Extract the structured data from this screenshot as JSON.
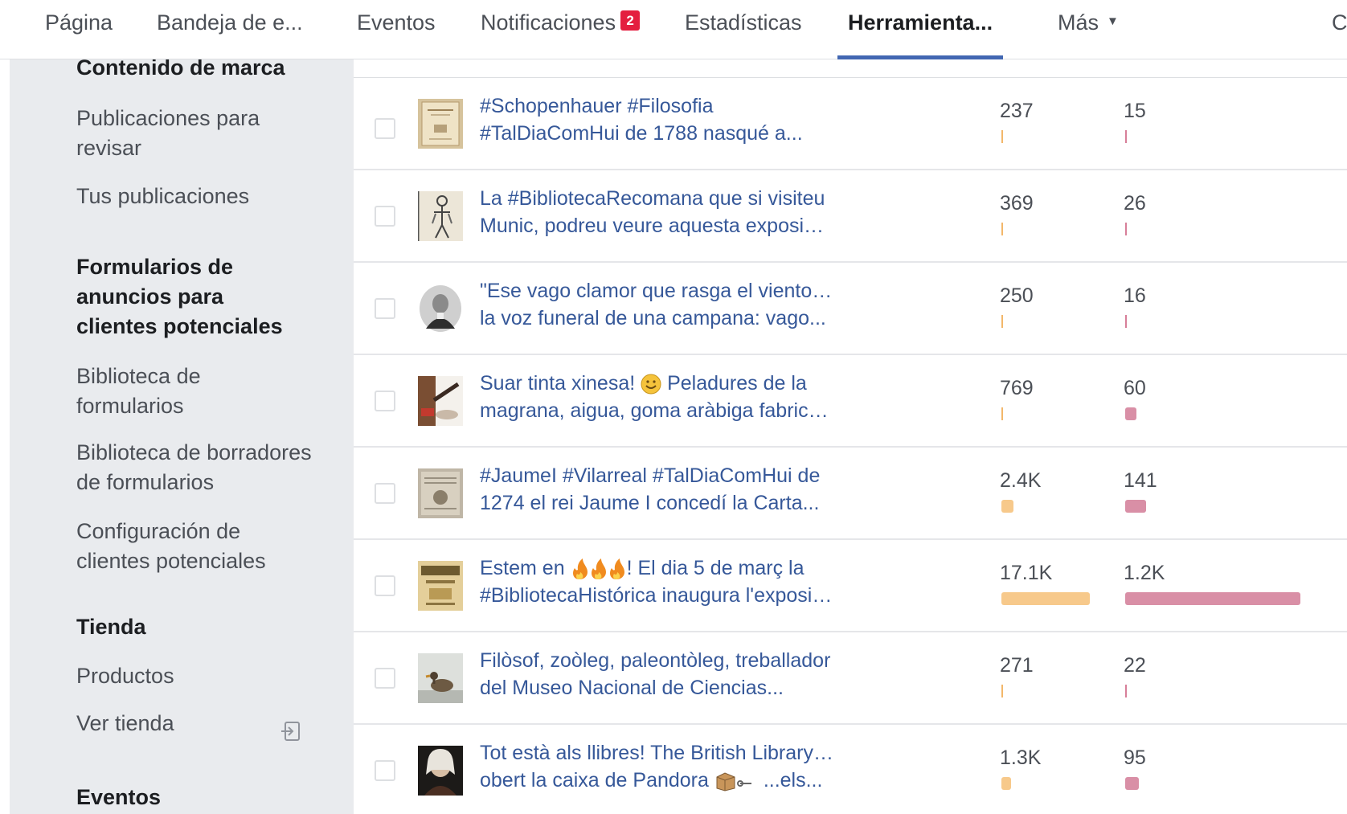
{
  "nav": {
    "tabs": [
      {
        "label": "Página"
      },
      {
        "label": "Bandeja de e..."
      },
      {
        "label": "Eventos"
      },
      {
        "label": "Notificaciones",
        "badge": "2"
      },
      {
        "label": "Estadísticas"
      },
      {
        "label": "Herramienta...",
        "active": true
      },
      {
        "label": "Más"
      },
      {
        "label": "C"
      }
    ]
  },
  "sidebar": {
    "items": [
      {
        "label": "Contenido de marca",
        "kind": "heading"
      },
      {
        "label": "Publicaciones para revisar",
        "kind": "link"
      },
      {
        "label": "Tus publicaciones",
        "kind": "link"
      },
      {
        "label": "Formularios de anuncios para clientes potenciales",
        "kind": "heading"
      },
      {
        "label": "Biblioteca de formularios",
        "kind": "link"
      },
      {
        "label": "Biblioteca de borradores de formularios",
        "kind": "link"
      },
      {
        "label": "Configuración de clientes potenciales",
        "kind": "link"
      },
      {
        "label": "Tienda",
        "kind": "heading"
      },
      {
        "label": "Productos",
        "kind": "link"
      },
      {
        "label": "Ver tienda",
        "kind": "link",
        "icon": "exit-icon"
      },
      {
        "label": "Eventos",
        "kind": "heading"
      }
    ]
  },
  "colors": {
    "accent": "#4267b2",
    "link": "#365899",
    "reach_bar": "#f7c98b",
    "engagement_bar": "#d98fa6",
    "badge": "#e41e3f"
  },
  "posts": [
    {
      "line1": "#Schopenhauer #Filosofia",
      "line2": "#TalDiaComHui de 1788 nasqué a...",
      "thumb": "book-cover",
      "reach": "237",
      "reach_value": 237,
      "engagement": "15",
      "engagement_value": 15
    },
    {
      "line1": "La #BibliotecaRecomana que si visiteu",
      "line2": "Munic, podreu veure aquesta exposició...",
      "thumb": "anatomy-print",
      "reach": "369",
      "reach_value": 369,
      "engagement": "26",
      "engagement_value": 26
    },
    {
      "line1": "\"Ese vago clamor que rasga el viento es",
      "line2": "la voz funeral de una campana: vago...",
      "thumb": "portrait-oval",
      "reach": "250",
      "reach_value": 250,
      "engagement": "16",
      "engagement_value": 16
    },
    {
      "line1": "Suar tinta xinesa!",
      "line1_emoji": "smiling-face-emoji",
      "line1_rest": " Peladures de la",
      "line2": "magrana, aigua, goma aràbiga fabricad...",
      "thumb": "ink-brush",
      "reach": "769",
      "reach_value": 769,
      "engagement": "60",
      "engagement_value": 60
    },
    {
      "line1": "#JaumeI #Vilarreal #TalDiaComHui de",
      "line2": "1274 el rei Jaume I concedí la Carta...",
      "thumb": "manuscript",
      "reach": "2.4K",
      "reach_value": 2400,
      "engagement": "141",
      "engagement_value": 141
    },
    {
      "line1": "Estem en",
      "line1_emoji": "fire-emoji",
      "line1_rest": "! El dia 5 de març la",
      "line2": "#BibliotecaHistórica inaugura l'exposici...",
      "thumb": "poster",
      "reach": "17.1K",
      "reach_value": 17100,
      "engagement": "1.2K",
      "engagement_value": 1200
    },
    {
      "line1": "Filòsof, zoòleg, paleontòleg, treballador",
      "line2": "del Museo Nacional de Ciencias...",
      "thumb": "duck-illustration",
      "reach": "271",
      "reach_value": 271,
      "engagement": "22",
      "engagement_value": 22
    },
    {
      "line1": "Tot està als llibres! The British Library ha",
      "line2": "obert la caixa de Pandora",
      "line2_emoji": "box-emoji",
      "line2_rest": " ...els...",
      "thumb": "portrait-wig",
      "reach": "1.3K",
      "reach_value": 1300,
      "engagement": "95",
      "engagement_value": 95
    }
  ]
}
